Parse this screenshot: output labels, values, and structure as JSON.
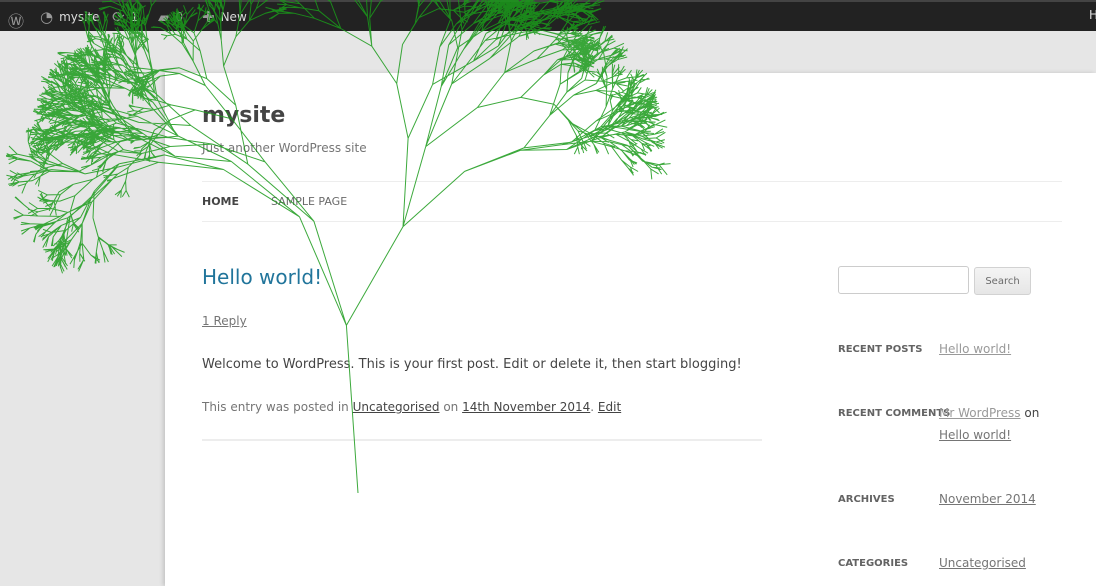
{
  "adminbar": {
    "site": "mysite",
    "updates": "1",
    "comments": "0",
    "new": "New",
    "howdy": "H"
  },
  "site": {
    "title": "mysite",
    "tagline": "Just another WordPress site"
  },
  "nav": [
    {
      "label": "Home"
    },
    {
      "label": "Sample Page"
    }
  ],
  "post": {
    "title": "Hello world!",
    "reply": "1 Reply",
    "body": "Welcome to WordPress. This is your first post. Edit or delete it, then start blogging!",
    "meta_prefix": "This entry was posted in ",
    "category": "Uncategorised",
    "meta_on": " on ",
    "date": "14th November 2014",
    "meta_sep": ". ",
    "edit": "Edit"
  },
  "sidebar": {
    "search_button": "Search",
    "search_value": "",
    "recent_posts": {
      "title": "Recent Posts",
      "item": "Hello world!"
    },
    "recent_comments": {
      "title": "Recent Comments",
      "author": "Mr WordPress",
      "on": " on",
      "post": "Hello world!"
    },
    "archives": {
      "title": "Archives",
      "item": "November 2014"
    },
    "categories": {
      "title": "Categories",
      "item": "Uncategorised"
    }
  },
  "colors": {
    "tree": "#1a9a1a",
    "link": "#21759b",
    "adminbar": "#222222"
  }
}
